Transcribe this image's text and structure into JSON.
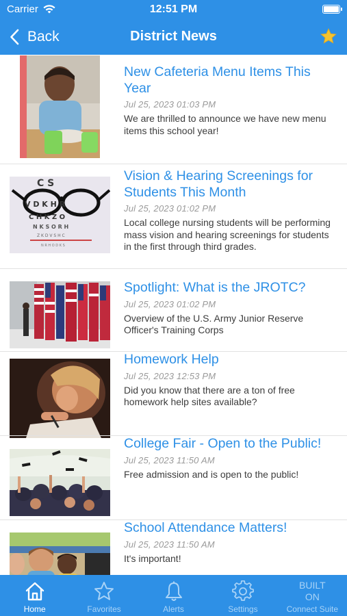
{
  "status_bar": {
    "carrier": "Carrier",
    "time": "12:51 PM"
  },
  "nav": {
    "back_label": "Back",
    "title": "District News"
  },
  "news": [
    {
      "title": "New Cafeteria Menu Items This Year",
      "date": "Jul 25, 2023  01:03 PM",
      "description": "We are thrilled to announce we have new menu items this school year!"
    },
    {
      "title": "Vision & Hearing Screenings for Students This Month",
      "date": "Jul 25, 2023  01:02 PM",
      "description": "Local college nursing students will be performing mass vision and hearing screenings for students in the first through third grades."
    },
    {
      "title": "Spotlight: What is the JROTC?",
      "date": "Jul 25, 2023  01:02 PM",
      "description": "Overview of the U.S. Army Junior Reserve Officer's Training Corps"
    },
    {
      "title": "Homework Help",
      "date": "Jul 25, 2023  12:53 PM",
      "description": "Did you know that there are a ton of free homework help sites available?"
    },
    {
      "title": "College Fair - Open to the Public!",
      "date": "Jul 25, 2023  11:50 AM",
      "description": "Free admission and is open to the public!"
    },
    {
      "title": "School Attendance Matters!",
      "date": "Jul 25, 2023  11:50 AM",
      "description": "It's important!"
    }
  ],
  "tabs": [
    {
      "label": "Home",
      "icon": "home-icon",
      "active": true
    },
    {
      "label": "Favorites",
      "icon": "star-icon",
      "active": false
    },
    {
      "label": "Alerts",
      "icon": "bell-icon",
      "active": false
    },
    {
      "label": "Settings",
      "icon": "gear-icon",
      "active": false
    },
    {
      "label": "Connect Suite",
      "icon": "built-on-logo",
      "active": false
    }
  ],
  "built_on_label": "BUILT ON",
  "colors": {
    "brand_blue": "#2e90e6",
    "title_blue": "#2e90e6",
    "favorite_star": "#f5c330",
    "inactive_tab": "#a9d3f7"
  }
}
